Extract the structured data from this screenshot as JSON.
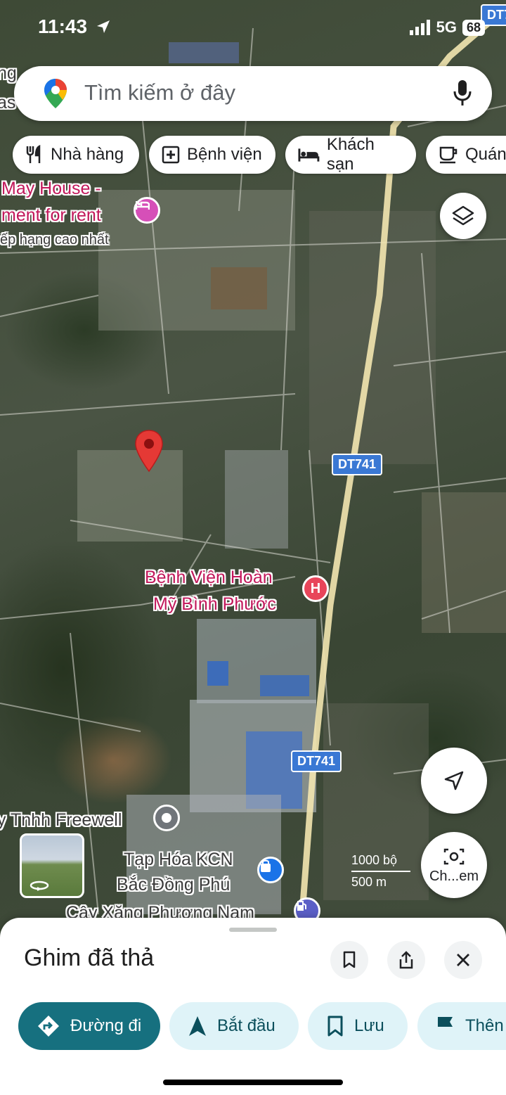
{
  "status_bar": {
    "time": "11:43",
    "network": "5G",
    "battery": "68"
  },
  "search": {
    "placeholder": "Tìm kiếm ở đây"
  },
  "chips": [
    {
      "label": "Nhà hàng",
      "icon": "restaurant-icon"
    },
    {
      "label": "Bệnh viện",
      "icon": "hospital-icon"
    },
    {
      "label": "Khách sạn",
      "icon": "hotel-icon"
    },
    {
      "label": "Quán",
      "icon": "cafe-icon"
    }
  ],
  "map": {
    "labels": {
      "may_house_1": "May House -",
      "may_house_2": "ment for rent",
      "may_house_3": "ếp hạng cao nhất",
      "hospital_1": "Bệnh Viện Hoàn",
      "hospital_2": "Mỹ Bình Phước",
      "freewell": "y Tnhh Freewell",
      "tap_hoa_1": "Tạp Hóa KCN",
      "tap_hoa_2": "Bắc Đồng Phú",
      "cay_xang": "Cây Xăng Phương Nam",
      "edge_top_1": "ng",
      "edge_top_2": "as"
    },
    "road_shields": {
      "top_right": "DT7",
      "mid": "DT741",
      "lower": "DT741"
    },
    "scale": {
      "feet": "1000 bộ",
      "meters": "500 m"
    },
    "poi_hospital_letter": "H",
    "colors": {
      "pin": "#e53935",
      "hospital_poi": "#e8455a",
      "hotel_poi": "#d64fb8",
      "shop_poi": "#1a73e8",
      "fuel_poi": "#5b5fc7",
      "road": "#e8d9a0"
    }
  },
  "fabs": {
    "street_view_label": "Ch...em"
  },
  "sheet": {
    "title": "Ghim đã thả",
    "actions": [
      {
        "label": "Đường đi",
        "icon": "directions-icon"
      },
      {
        "label": "Bắt đầu",
        "icon": "navigation-arrow-icon"
      },
      {
        "label": "Lưu",
        "icon": "bookmark-icon"
      },
      {
        "label": "Thên",
        "icon": "flag-icon"
      }
    ]
  }
}
